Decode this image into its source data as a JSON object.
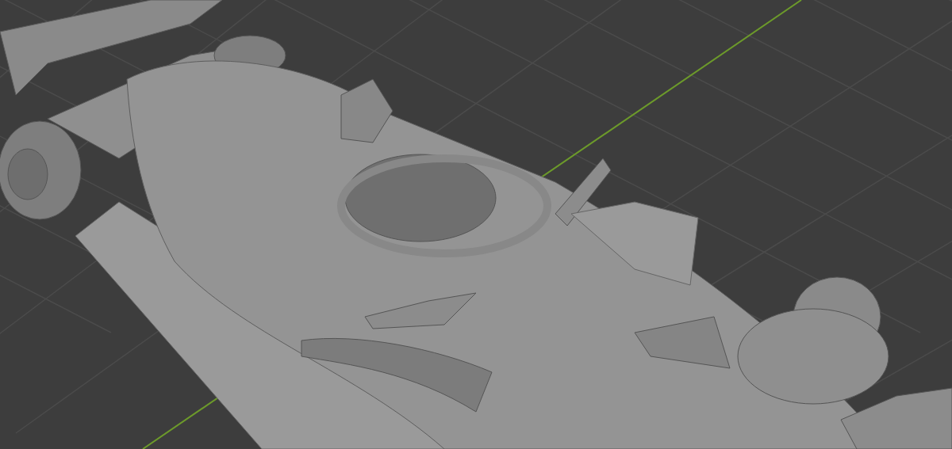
{
  "viewport": {
    "floor_grid": true,
    "y_axis": true
  }
}
